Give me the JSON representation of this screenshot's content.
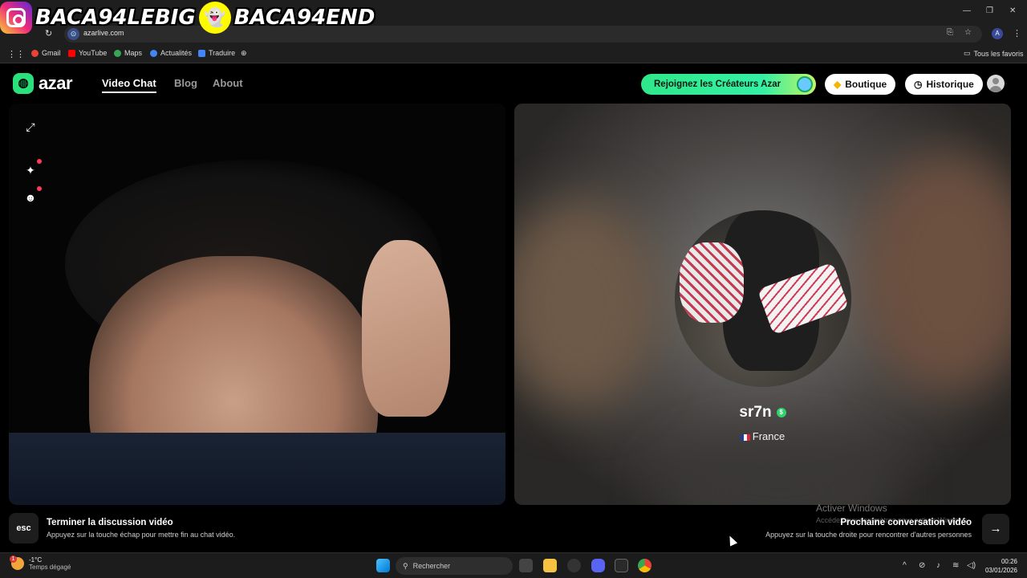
{
  "overlay": {
    "instagram_handle": "BACA94LEBIG",
    "snapchat_handle": "BACA94END"
  },
  "browser": {
    "url": "azarlive.com",
    "bookmarks": [
      "Gmail",
      "YouTube",
      "Maps",
      "Actualités",
      "Traduire"
    ],
    "all_favorites": "Tous les favoris"
  },
  "app": {
    "logo": "azar",
    "nav": [
      "Video Chat",
      "Blog",
      "About"
    ],
    "creators_button": "Rejoignez les Créateurs Azar",
    "shop_button": "Boutique",
    "history_button": "Historique"
  },
  "remote": {
    "username": "sr7n",
    "country": "France"
  },
  "controls": {
    "esc_key": "esc",
    "end_title": "Terminer la discussion vidéo",
    "end_sub": "Appuyez sur la touche échap pour mettre fin au chat vidéo.",
    "next_title": "Prochaine conversation vidéo",
    "next_sub": "Appuyez sur la touche droite pour rencontrer d'autres personnes",
    "next_arrow": "→"
  },
  "watermark": {
    "title": "Activer Windows",
    "sub": "Accédez aux paramètres pour activer Windows."
  },
  "taskbar": {
    "weather_badge": "1",
    "temp": "-1°C",
    "weather_desc": "Temps dégagé",
    "search_placeholder": "Rechercher",
    "time": "00:26",
    "date": "03/01/2026"
  },
  "colors": {
    "accent": "#2fe88a",
    "verify": "#2ed36d",
    "dot": "#ff3b5c"
  }
}
